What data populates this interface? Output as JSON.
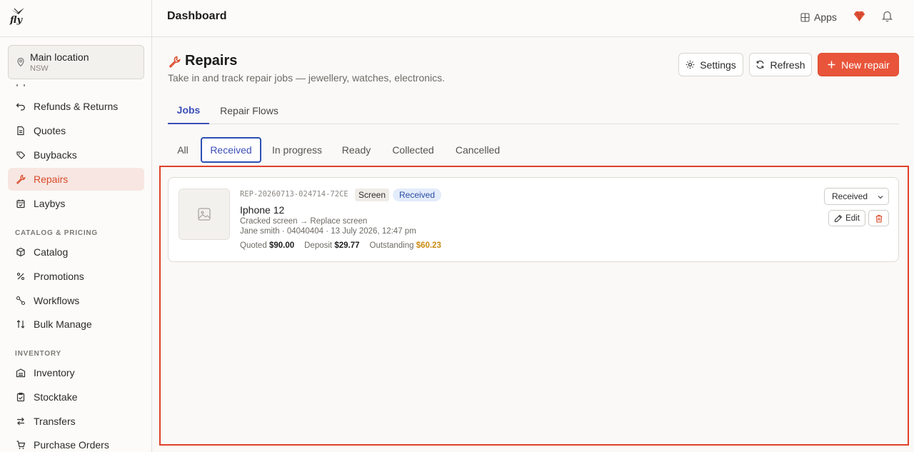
{
  "app": {
    "logo_text": "fly"
  },
  "location": {
    "name": "Main location",
    "region": "NSW"
  },
  "sidebar": {
    "items_top": [
      {
        "label": "Refunds & Returns",
        "icon": "undo-icon"
      },
      {
        "label": "Quotes",
        "icon": "document-icon"
      },
      {
        "label": "Buybacks",
        "icon": "tag-icon"
      },
      {
        "label": "Repairs",
        "icon": "wrench-icon",
        "active": true
      },
      {
        "label": "Laybys",
        "icon": "calendar-icon"
      }
    ],
    "section_catalog": "CATALOG & PRICING",
    "items_catalog": [
      {
        "label": "Catalog",
        "icon": "box-icon"
      },
      {
        "label": "Promotions",
        "icon": "percent-icon"
      },
      {
        "label": "Workflows",
        "icon": "workflow-icon"
      },
      {
        "label": "Bulk Manage",
        "icon": "sort-icon"
      }
    ],
    "section_inventory": "INVENTORY",
    "items_inventory": [
      {
        "label": "Inventory",
        "icon": "warehouse-icon"
      },
      {
        "label": "Stocktake",
        "icon": "clipboard-icon"
      },
      {
        "label": "Transfers",
        "icon": "transfer-icon"
      },
      {
        "label": "Purchase Orders",
        "icon": "cart-icon"
      }
    ]
  },
  "topbar": {
    "title": "Dashboard",
    "apps_label": "Apps"
  },
  "page": {
    "title": "Repairs",
    "subtitle": "Take in and track repair jobs — jewellery, watches, electronics.",
    "settings_label": "Settings",
    "refresh_label": "Refresh",
    "new_label": "New repair"
  },
  "tabs": [
    {
      "label": "Jobs",
      "active": true
    },
    {
      "label": "Repair Flows",
      "active": false
    }
  ],
  "filters": [
    {
      "label": "All"
    },
    {
      "label": "Received",
      "active": true
    },
    {
      "label": "In progress"
    },
    {
      "label": "Ready"
    },
    {
      "label": "Collected"
    },
    {
      "label": "Cancelled"
    }
  ],
  "job": {
    "ref": "REP-20260713-024714-72CE",
    "type": "Screen",
    "status": "Received",
    "title": "Iphone 12",
    "issue": "Cracked screen → Replace screen",
    "customer_line": "Jane smith · 04040404 · 13 July 2026, 12:47 pm",
    "quoted_label": "Quoted",
    "quoted_value": "$90.00",
    "deposit_label": "Deposit",
    "deposit_value": "$29.77",
    "outstanding_label": "Outstanding",
    "outstanding_value": "$60.23",
    "select_value": "Received",
    "edit_label": "Edit"
  },
  "colors": {
    "accent": "#e8553a",
    "active_tab": "#3b4fb8",
    "highlight_frame": "#e0402b",
    "outstanding": "#c98a12"
  }
}
